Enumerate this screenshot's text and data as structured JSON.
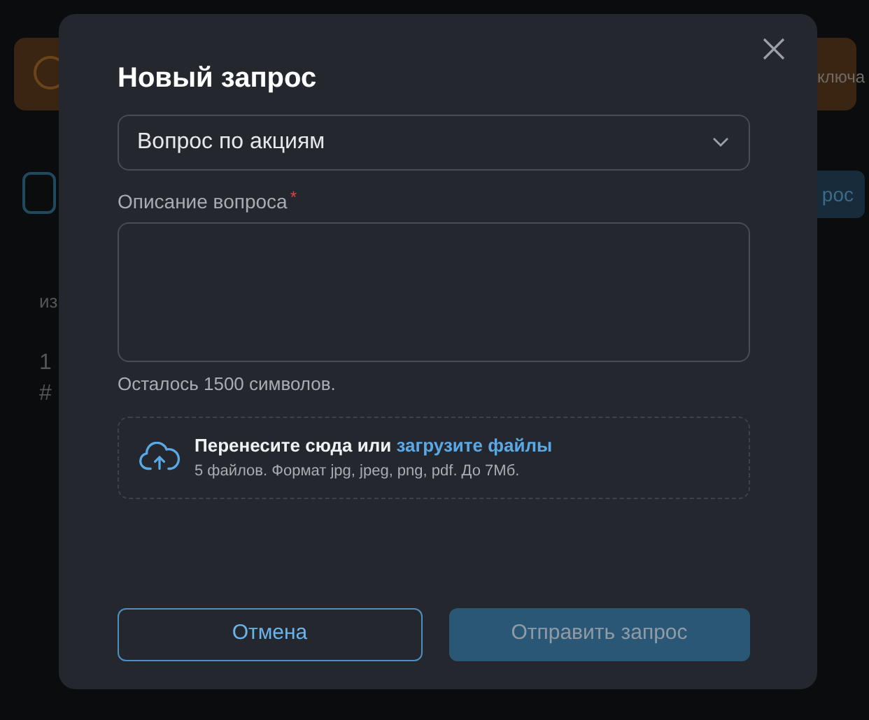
{
  "background": {
    "banner_text": "ключа",
    "button_label": "рос",
    "column_header": "из",
    "row_texts": [
      "1",
      "#"
    ]
  },
  "dialog": {
    "title": "Новый запрос",
    "select": {
      "value": "Вопрос по акциям"
    },
    "description": {
      "label": "Описание вопроса",
      "required": true,
      "required_mark": "*"
    },
    "counter": "Осталось 1500 символов.",
    "dropzone": {
      "text": "Перенесите сюда или",
      "link": "загрузите файлы",
      "hint": "5 файлов. Формат jpg, jpeg, png, pdf. До 7Мб."
    },
    "buttons": [
      {
        "label": "Отмена",
        "kind": "secondary",
        "disabled": false
      },
      {
        "label": "Отправить запрос",
        "kind": "primary",
        "disabled": true
      }
    ]
  }
}
